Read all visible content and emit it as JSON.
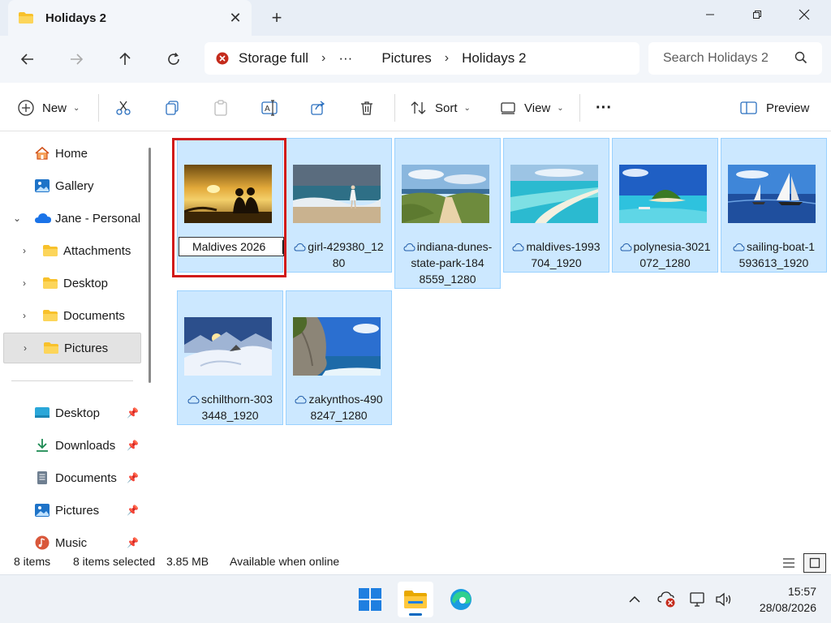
{
  "window": {
    "tab_title": "Holidays 2",
    "new_tab": "+"
  },
  "address": {
    "storage_status": "Storage full",
    "overflow": "···",
    "crumbs": [
      "Pictures",
      "Holidays 2"
    ],
    "search_placeholder": "Search Holidays 2"
  },
  "toolbar": {
    "new_label": "New",
    "sort_label": "Sort",
    "view_label": "View",
    "more_label": "···",
    "preview_label": "Preview"
  },
  "sidebar": {
    "items": [
      {
        "label": "Home",
        "icon": "home-icon"
      },
      {
        "label": "Gallery",
        "icon": "gallery-icon"
      },
      {
        "label": "Jane - Personal",
        "icon": "onedrive-cloud-icon"
      },
      {
        "label": "Attachments",
        "icon": "folder-icon"
      },
      {
        "label": "Desktop",
        "icon": "folder-icon"
      },
      {
        "label": "Documents",
        "icon": "folder-icon"
      },
      {
        "label": "Pictures",
        "icon": "folder-icon"
      }
    ],
    "quick": [
      {
        "label": "Desktop",
        "icon": "desktop-icon"
      },
      {
        "label": "Downloads",
        "icon": "download-icon"
      },
      {
        "label": "Documents",
        "icon": "document-icon"
      },
      {
        "label": "Pictures",
        "icon": "pictures-icon"
      },
      {
        "label": "Music",
        "icon": "music-icon"
      }
    ]
  },
  "files": [
    {
      "name": "Maldives 2026",
      "renaming": true,
      "lines": [
        "Maldives 2026"
      ]
    },
    {
      "name": "girl-429380_1280",
      "lines": [
        "girl-429380_12",
        "80"
      ]
    },
    {
      "name": "indiana-dunes-state-park-1848559_1280",
      "lines": [
        "indiana-dunes-",
        "state-park-184",
        "8559_1280"
      ]
    },
    {
      "name": "maldives-1993704_1920",
      "lines": [
        "maldives-1993",
        "704_1920"
      ]
    },
    {
      "name": "polynesia-3021072_1280",
      "lines": [
        "polynesia-3021",
        "072_1280"
      ]
    },
    {
      "name": "sailing-boat-1593613_1920",
      "lines": [
        "sailing-boat-1",
        "593613_1920"
      ]
    },
    {
      "name": "schilthorn-3033448_1920",
      "lines": [
        "schilthorn-303",
        "3448_1920"
      ]
    },
    {
      "name": "zakynthos-4908247_1280",
      "lines": [
        "zakynthos-490",
        "8247_1280"
      ]
    }
  ],
  "status": {
    "count": "8 items",
    "selected": "8 items selected",
    "size": "3.85 MB",
    "availability": "Available when online"
  },
  "clock": {
    "time": "15:57",
    "date": "28/08/2026"
  },
  "colors": {
    "selection_fill": "#cce8ff",
    "selection_border": "#99d1ff",
    "highlight": "#d11a1a",
    "accent": "#0067c0",
    "folder": "#f8c12b"
  }
}
